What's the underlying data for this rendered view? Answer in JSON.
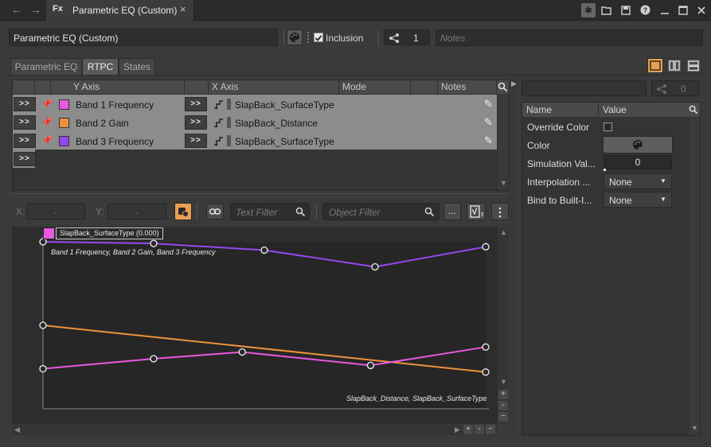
{
  "window": {
    "tab_title": "Parametric EQ (Custom)",
    "tab_icon": "Fx",
    "close_glyph": "×",
    "back_glyph": "←",
    "forward_glyph": "→"
  },
  "header": {
    "object_name": "Parametric EQ (Custom)",
    "inclusion_label": "Inclusion",
    "inclusion_checked": true,
    "share_count": "1",
    "notes_placeholder": "Notes"
  },
  "tabs": [
    {
      "label": "Parametric EQ",
      "active": false
    },
    {
      "label": "RTPC",
      "active": true
    },
    {
      "label": "States",
      "active": false
    }
  ],
  "rtpc_table": {
    "columns": [
      "Y Axis",
      "X Axis",
      "Mode",
      "Notes"
    ],
    "expand_glyph": ">>",
    "rows": [
      {
        "y_axis": "Band 1 Frequency",
        "color": "#e858e0",
        "x_axis": "SlapBack_SurfaceType"
      },
      {
        "y_axis": "Band 2 Gain",
        "color": "#f0923c",
        "x_axis": "SlapBack_Distance"
      },
      {
        "y_axis": "Band 3 Frequency",
        "color": "#9448f0",
        "x_axis": "SlapBack_SurfaceType"
      }
    ]
  },
  "graph_toolbar": {
    "x_label": "X:",
    "y_label": "Y:",
    "x_value": "-",
    "y_value": "-",
    "text_filter_placeholder": "Text Filter",
    "object_filter_placeholder": "Object Filter",
    "ellipsis": "..."
  },
  "chart_data": {
    "type": "line",
    "tooltip": "SlapBack_SurfaceType (0.000)",
    "top_label": "Band 1 Frequency, Band 2 Gain, Band 3 Frequency",
    "bottom_label": "SlapBack_Distance, SlapBack_SurfaceType",
    "xlim": [
      0,
      1
    ],
    "ylim": [
      0,
      1
    ],
    "series": [
      {
        "color": "#9448f0",
        "x": [
          0,
          0.25,
          0.5,
          0.75,
          1
        ],
        "y": [
          1.0,
          0.99,
          0.95,
          0.85,
          0.97
        ]
      },
      {
        "color": "#f0923c",
        "x": [
          0,
          1
        ],
        "y": [
          0.5,
          0.22
        ]
      },
      {
        "color": "#e858e0",
        "x": [
          0,
          0.25,
          0.45,
          0.74,
          1
        ],
        "y": [
          0.24,
          0.3,
          0.34,
          0.26,
          0.37
        ]
      }
    ]
  },
  "properties": {
    "share_count": "0",
    "columns": [
      "Name",
      "Value"
    ],
    "override_color_label": "Override Color",
    "override_color_checked": false,
    "color_label": "Color",
    "simulation_label": "Simulation Val...",
    "simulation_value": "0",
    "interpolation_label": "Interpolation ...",
    "interpolation_value": "None",
    "bind_label": "Bind to Built-I...",
    "bind_value": "None"
  }
}
